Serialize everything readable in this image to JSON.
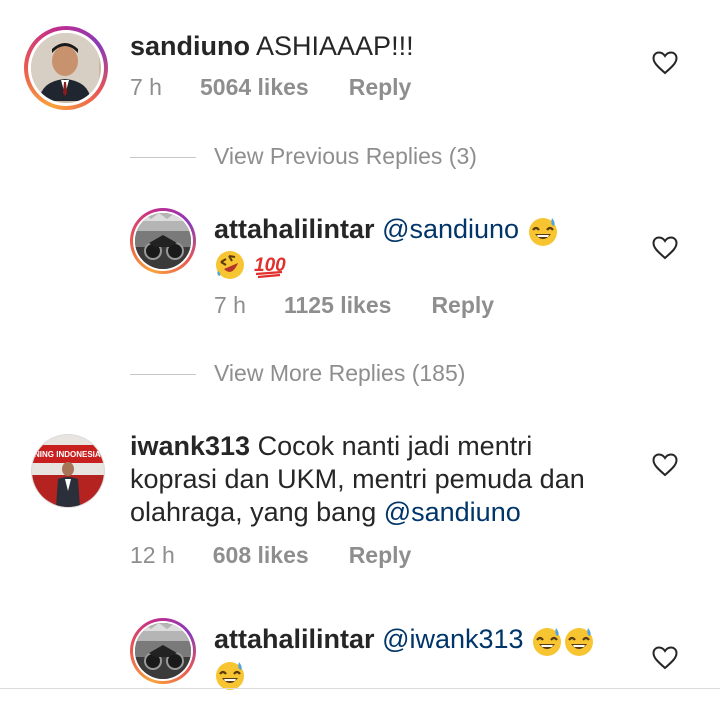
{
  "comments": [
    {
      "username": "sandiuno",
      "text": " ASHIAAAP!!!",
      "time": "7 h",
      "likes": "5064 likes",
      "reply": "Reply"
    },
    {
      "view_previous": "View Previous Replies (3)"
    },
    {
      "username": "attahalilintar",
      "mention": "@sandiuno",
      "time": "7 h",
      "likes": "1125 likes",
      "reply": "Reply",
      "emojis": [
        "grinning-sweat-emoji",
        "rofl-emoji",
        "hundred-points-emoji"
      ]
    },
    {
      "view_more": "View More Replies (185)"
    },
    {
      "username": "iwank313",
      "text_line1": " Cocok nanti jadi mentri",
      "text_line2": "koprasi dan UKM, mentri pemuda dan",
      "text_line3": "olahraga, yang bang ",
      "mention": "@sandiuno",
      "time": "12 h",
      "likes": "608 likes",
      "reply": "Reply",
      "avatar_banner": "NING INDONESIA"
    },
    {
      "username": "attahalilintar",
      "mention": "@iwank313",
      "emojis": [
        "grinning-sweat-emoji",
        "grinning-sweat-emoji",
        "grinning-sweat-emoji"
      ]
    }
  ],
  "colors": {
    "text": "#262626",
    "meta": "#8e8e8e",
    "mention": "#003569",
    "story_ring": "#e95950"
  }
}
